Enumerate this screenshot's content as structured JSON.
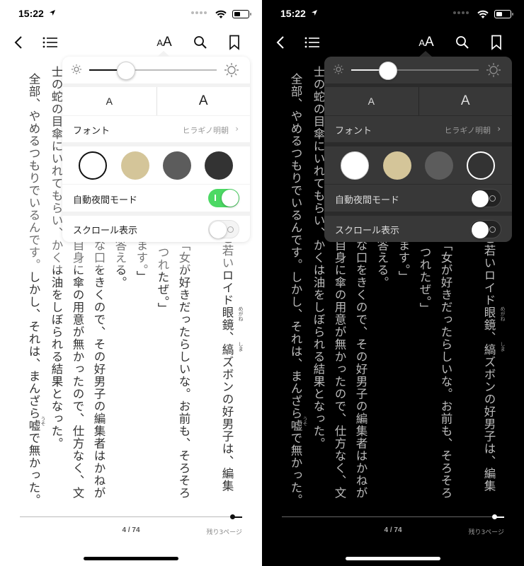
{
  "status": {
    "time": "15:22"
  },
  "nav": {
    "aa_small": "A",
    "aa_large": "A"
  },
  "settings": {
    "brightness": 0.29,
    "size_small": "A",
    "size_large": "A",
    "font_label": "フォント",
    "font_value": "ヒラギノ明朝",
    "themes": [
      "#ffffff",
      "#d4c599",
      "#5c5c5c",
      "#333333"
    ],
    "night_mode_label": "自動夜間モード",
    "scroll_label": "スクロール表示"
  },
  "light": {
    "night_mode_on": true,
    "scroll_on": false,
    "selected_theme": 0
  },
  "dark": {
    "night_mode_on": false,
    "scroll_on": false,
    "selected_theme": 3
  },
  "accent": {
    "toggle_on": "#4cd964"
  },
  "book": {
    "columns": [
      "ど若いロイド眼鏡、縞ズボンの好男子は、編集",
      "「女が好きだったらしいな。お前も、そろそろ",
      "つれたぜ。」",
      "ます。」",
      "答える。",
      "な口をきくので、その好男子の編集者はかねが",
      "自身に傘の用意が無かったので、仕方なく、文",
      "士の蛇の目傘にいれてもらい、かくは油をしぼられる結果となった。",
      "全部、やめるつもりでいるんです。しかし、それは、まんざら嘘で無かった。"
    ],
    "ruby": {
      "megane": "めがね",
      "shima": "しま",
      "uso": "うそ"
    }
  },
  "footer": {
    "page": "4 / 74",
    "remaining": "残り3ページ",
    "progress": 0.97
  }
}
